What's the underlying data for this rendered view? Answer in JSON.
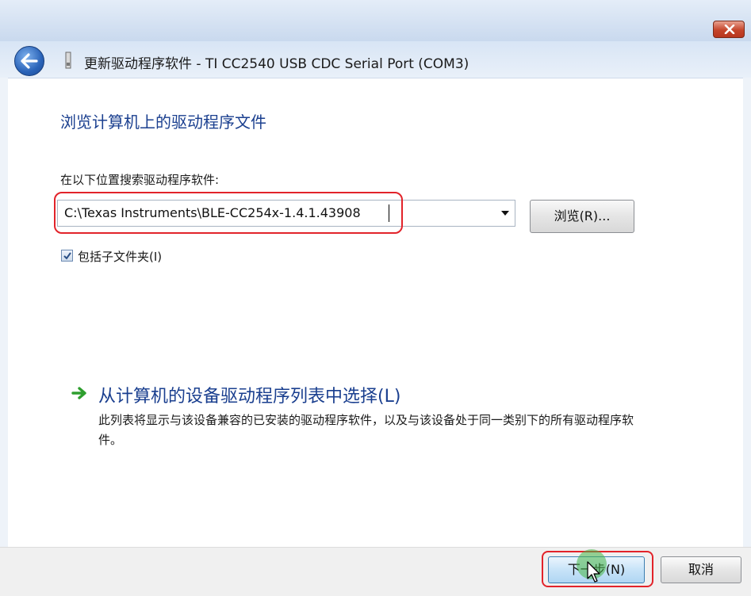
{
  "window": {
    "title": "更新驱动程序软件 - TI CC2540 USB CDC Serial Port (COM3)"
  },
  "page": {
    "heading": "浏览计算机上的驱动程序文件",
    "search_label": "在以下位置搜索驱动程序软件:",
    "path_value": "C:\\Texas Instruments\\BLE-CC254x-1.4.1.43908",
    "browse_label": "浏览(R)...",
    "include_subfolders_label": "包括子文件夹(I)",
    "include_subfolders_checked": true
  },
  "option": {
    "title": "从计算机的设备驱动程序列表中选择(L)",
    "description": "此列表将显示与该设备兼容的已安装的驱动程序软件，以及与该设备处于同一类别下的所有驱动程序软件。"
  },
  "footer": {
    "next_label": "下一步(N)",
    "cancel_label": "取消"
  },
  "colors": {
    "heading_blue": "#1a3f8f",
    "highlight_red": "#e2232a",
    "arrow_green": "#2e9e2e",
    "close_red": "#c5452b"
  },
  "icons": [
    "close-icon",
    "back-arrow-icon",
    "device-icon",
    "dropdown-arrow-icon",
    "checkmark-icon",
    "green-arrow-icon",
    "mouse-pointer-icon"
  ]
}
